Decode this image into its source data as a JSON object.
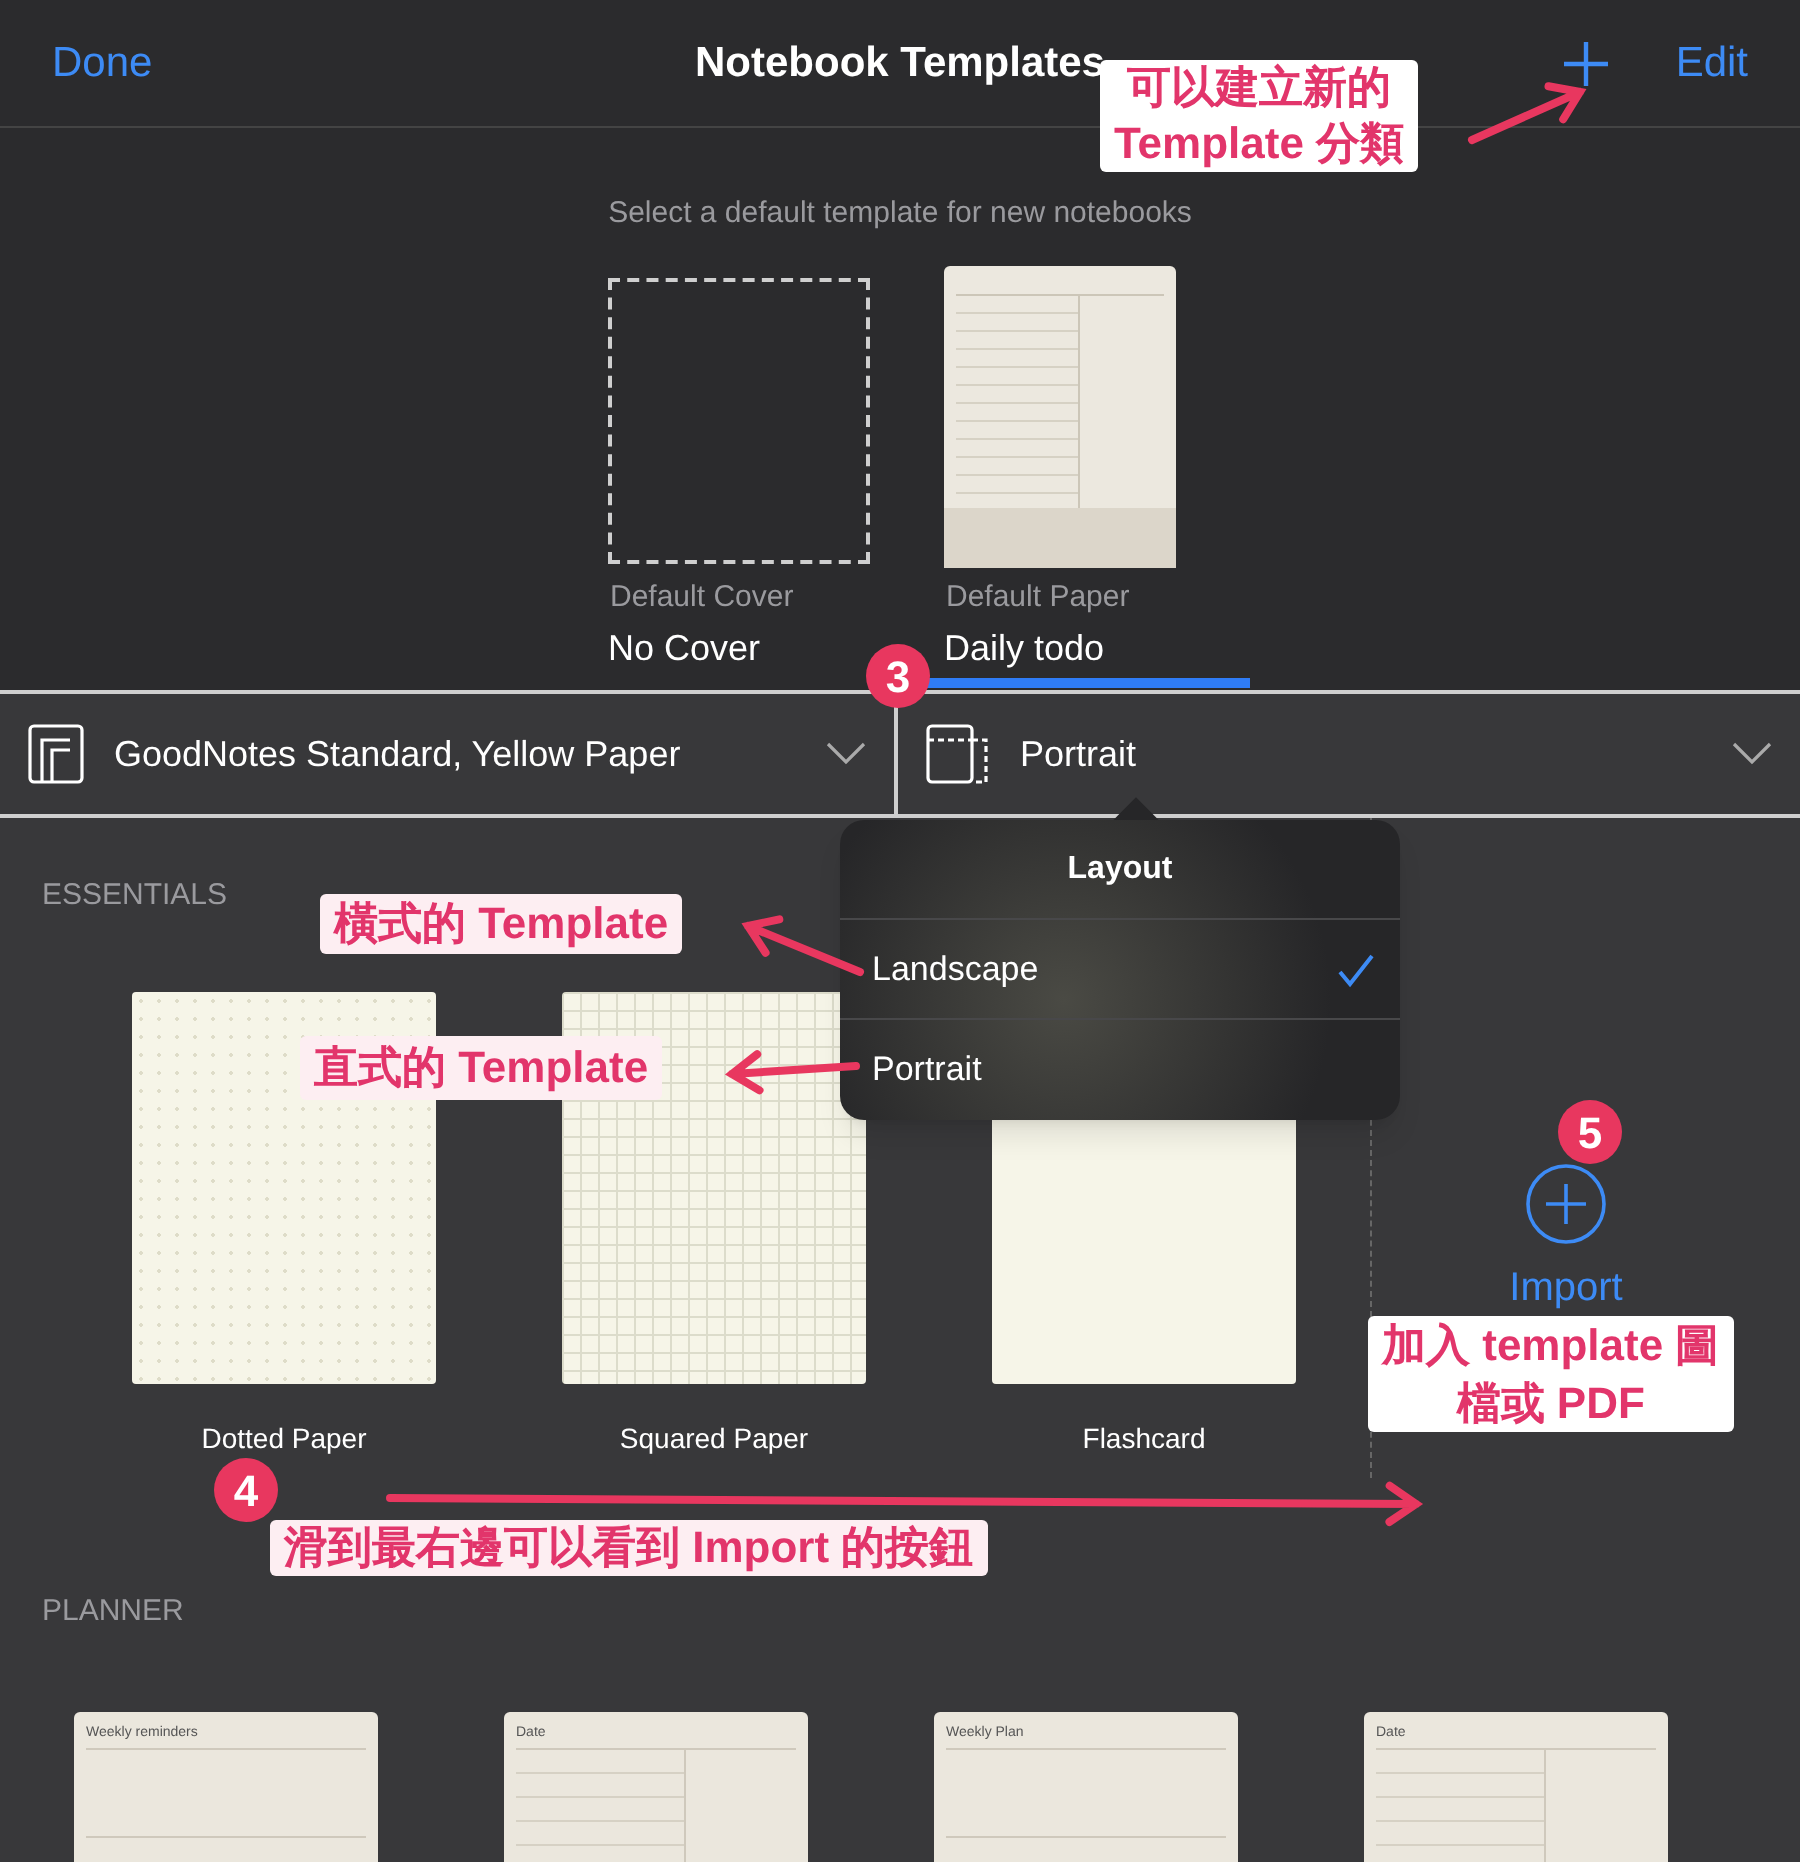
{
  "header": {
    "done": "Done",
    "title": "Notebook Templates",
    "edit": "Edit"
  },
  "defaults": {
    "prompt": "Select a default template for new notebooks",
    "items": [
      {
        "kind": "cover",
        "label": "Default Cover",
        "value": "No Cover",
        "selected": false
      },
      {
        "kind": "paper",
        "label": "Default Paper",
        "value": "Daily todo",
        "selected": true
      }
    ]
  },
  "selectors": [
    {
      "kind": "paper",
      "label": "GoodNotes Standard, Yellow Paper"
    },
    {
      "kind": "layout",
      "label": "Portrait"
    }
  ],
  "layout_menu": {
    "title": "Layout",
    "options": [
      {
        "label": "Landscape",
        "selected": true
      },
      {
        "label": "Portrait",
        "selected": false
      }
    ]
  },
  "sections": [
    {
      "title": "ESSENTIALS",
      "import": "Import",
      "templates": [
        {
          "kind": "dotted",
          "name": "Dotted Paper"
        },
        {
          "kind": "grid",
          "name": "Squared Paper"
        },
        {
          "kind": "flashcard",
          "name": "Flashcard"
        }
      ]
    },
    {
      "title": "PLANNER",
      "templates": [
        {
          "kind": "planner",
          "heading": "Weekly reminders"
        },
        {
          "kind": "todo",
          "heading": "Date"
        },
        {
          "kind": "planner",
          "heading": "Weekly Plan"
        },
        {
          "kind": "todo",
          "heading": "Date"
        }
      ]
    }
  ],
  "annotations": [
    {
      "kind": "label",
      "lines": [
        "可以建立新的",
        "Template 分類"
      ]
    },
    {
      "kind": "badge",
      "text": "3"
    },
    {
      "kind": "label",
      "lines": [
        "橫式的 Template"
      ]
    },
    {
      "kind": "label",
      "lines": [
        "直式的 Template"
      ]
    },
    {
      "kind": "badge",
      "text": "5"
    },
    {
      "kind": "label",
      "lines": [
        "加入 template 圖",
        "檔或 PDF"
      ]
    },
    {
      "kind": "badge",
      "text": "4"
    },
    {
      "kind": "label",
      "lines": [
        "滑到最右邊可以看到 Import 的按鈕"
      ]
    }
  ]
}
